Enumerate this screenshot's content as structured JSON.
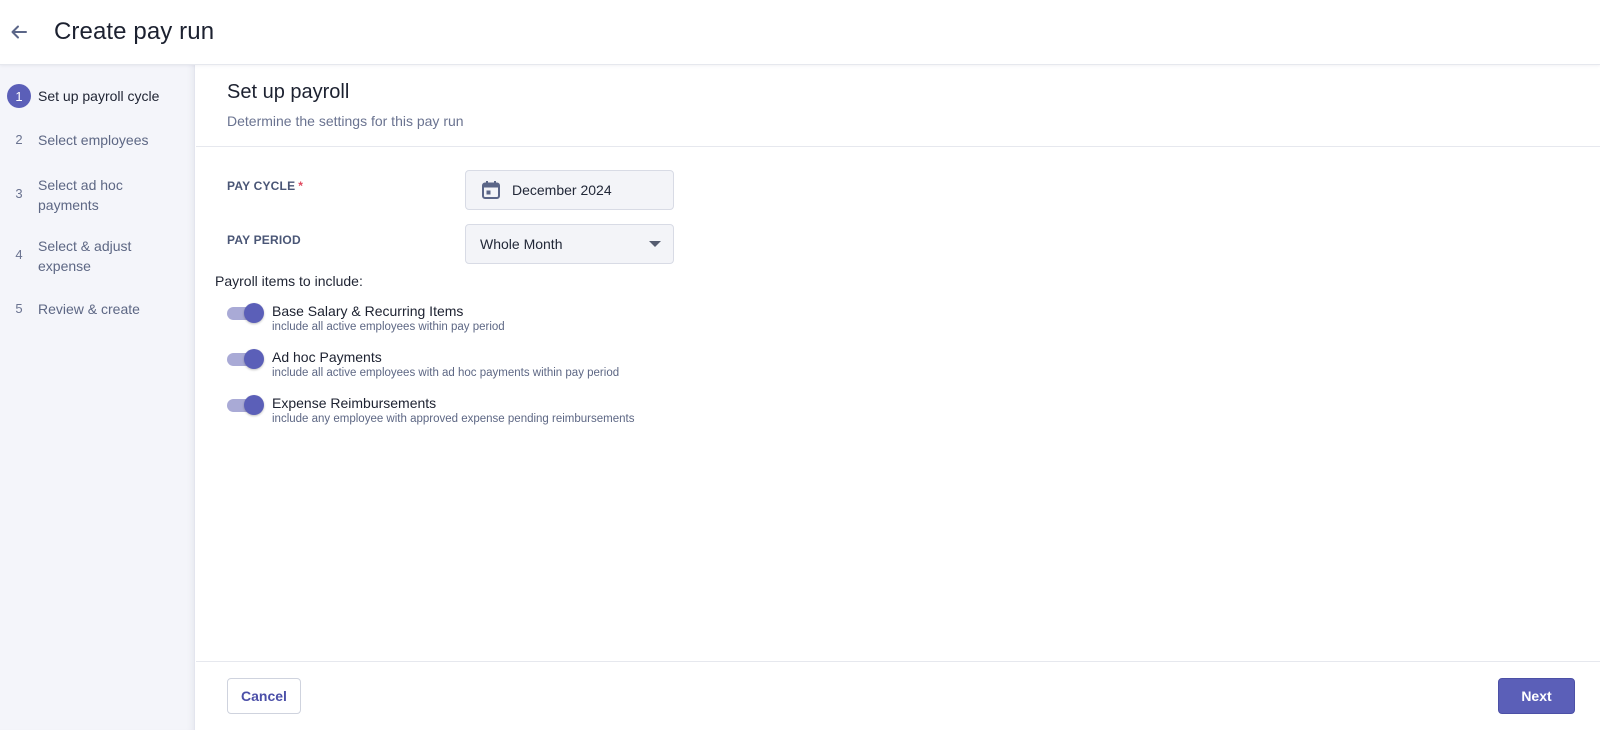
{
  "header": {
    "title": "Create pay run",
    "back_icon": "arrow-left-icon"
  },
  "sidebar": {
    "steps": [
      {
        "num": "1",
        "label": "Set up payroll cycle",
        "active": true
      },
      {
        "num": "2",
        "label": "Select employees",
        "active": false
      },
      {
        "num": "3",
        "label": "Select ad hoc payments",
        "active": false
      },
      {
        "num": "4",
        "label": "Select & adjust expense",
        "active": false
      },
      {
        "num": "5",
        "label": "Review & create",
        "active": false
      }
    ]
  },
  "section": {
    "title": "Set up payroll",
    "subtitle": "Determine the settings for this pay run"
  },
  "form": {
    "pay_cycle": {
      "label": "PAY CYCLE",
      "required_mark": "*",
      "value": "December 2024",
      "icon": "calendar-icon"
    },
    "pay_period": {
      "label": "PAY PERIOD",
      "value": "Whole Month",
      "icon": "caret-down-icon"
    }
  },
  "payroll_items": {
    "heading": "Payroll items to include:",
    "items": [
      {
        "title": "Base Salary & Recurring Items",
        "description": "include all active employees within pay period",
        "enabled": true
      },
      {
        "title": "Ad hoc Payments",
        "description": "include all active employees with ad hoc payments within pay period",
        "enabled": true
      },
      {
        "title": "Expense Reimbursements",
        "description": "include any employee with approved expense pending reimbursements",
        "enabled": true
      }
    ]
  },
  "footer": {
    "cancel_label": "Cancel",
    "next_label": "Next"
  },
  "colors": {
    "accent": "#5b5fb8",
    "toggle_track": "#a9aad6",
    "sidebar_bg": "#f4f5fa",
    "required": "#e04a5f"
  }
}
